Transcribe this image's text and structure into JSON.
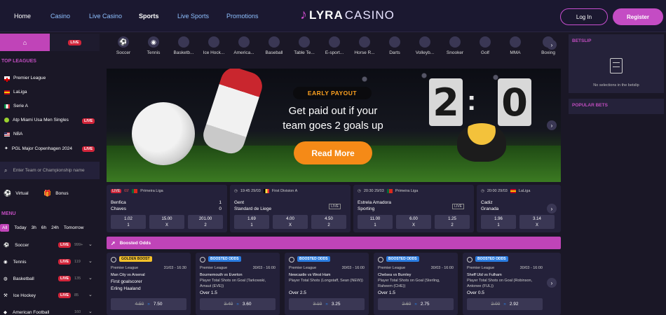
{
  "nav": {
    "items": [
      "Home",
      "Casino",
      "Live Casino",
      "Sports",
      "Live Sports",
      "Promotions"
    ],
    "logo_bold": "LYRA",
    "logo_light": "CASINO",
    "login": "Log In",
    "register": "Register"
  },
  "sidebar": {
    "live_tab": "LIVE",
    "top_leagues_title": "TOP LEAGUES",
    "leagues": [
      {
        "name": "Premier League",
        "live": ""
      },
      {
        "name": "LaLiga",
        "live": ""
      },
      {
        "name": "Serie A",
        "live": ""
      },
      {
        "name": "Atp Miami Usa Men Singles",
        "live": "LIVE"
      },
      {
        "name": "NBA",
        "live": ""
      },
      {
        "name": "PGL Major Copenhagen 2024",
        "live": "LIVE"
      }
    ],
    "search_placeholder": "Enter Team or Championship name",
    "virtual": "Virtual",
    "bonus": "Bonus",
    "menu_title": "MENU",
    "filters": [
      "All",
      "Today",
      "3h",
      "6h",
      "24h",
      "Tomorrow"
    ],
    "sports": [
      {
        "name": "Soccer",
        "live": "LIVE",
        "count": "999+"
      },
      {
        "name": "Tennis",
        "live": "LIVE",
        "count": "119"
      },
      {
        "name": "Basketball",
        "live": "LIVE",
        "count": "135"
      },
      {
        "name": "Ice Hockey",
        "live": "LIVE",
        "count": "85"
      },
      {
        "name": "American Football",
        "live": "",
        "count": "160"
      }
    ]
  },
  "sportsbar": [
    "Soccer",
    "Tennis",
    "Basketb...",
    "Ice Hock...",
    "America...",
    "Baseball",
    "Table Te...",
    "E-sport...",
    "Horse R...",
    "Darts",
    "Volleyb...",
    "Snooker",
    "Golf",
    "MMA",
    "Boxing"
  ],
  "banner": {
    "tag": "EARLY PAYOUT",
    "headline_1": "Get paid out if your",
    "headline_2": "team goes 2 goals up",
    "button": "Read More",
    "score_home": "2",
    "score_away": "0"
  },
  "matches": [
    {
      "status": "LIVE",
      "minute": "69'",
      "league": "Primeira Liga",
      "team1": "Benfica",
      "team2": "Chaves",
      "score1": "1",
      "score2": "0",
      "odds": [
        [
          "1.02",
          "1"
        ],
        [
          "15.00",
          "X"
        ],
        [
          "201.00",
          "2"
        ]
      ],
      "livetag": ""
    },
    {
      "status": "",
      "minute": "19:45 29/03",
      "league": "First Division A",
      "team1": "Gent",
      "team2": "Standard de Liege",
      "score1": "",
      "score2": "",
      "odds": [
        [
          "1.69",
          "1"
        ],
        [
          "4.00",
          "X"
        ],
        [
          "4.50",
          "2"
        ]
      ],
      "livetag": "LIVE"
    },
    {
      "status": "",
      "minute": "20:30 29/03",
      "league": "Primeira Liga",
      "team1": "Estrela Amadora",
      "team2": "Sporting",
      "score1": "",
      "score2": "",
      "odds": [
        [
          "11.00",
          "1"
        ],
        [
          "6.00",
          "X"
        ],
        [
          "1.25",
          "2"
        ]
      ],
      "livetag": "LIVE"
    },
    {
      "status": "",
      "minute": "20:00 29/03",
      "league": "LaLiga",
      "team1": "Cadiz",
      "team2": "Granada",
      "score1": "",
      "score2": "",
      "odds": [
        [
          "1.96",
          "1"
        ],
        [
          "3.14",
          "X"
        ],
        [
          "",
          ""
        ]
      ],
      "livetag": ""
    }
  ],
  "boosted": {
    "title": "Boosted Odds",
    "cards": [
      {
        "tag": "GOLDEN BOOST",
        "league": "Premier League",
        "date": "31/03 - 16:30",
        "title": "Man City vs Arsenal",
        "sub1": "First goalscorer",
        "sub2": "Erling Haaland",
        "old": "4.50",
        "new": "7.50",
        "gold": true
      },
      {
        "tag": "BOOSTED ODDS",
        "league": "Premier League",
        "date": "30/03 - 16:00",
        "title": "Bournemouth vs Everton",
        "sub1": "Player Total Shots on Goal (Tarkowski, Arnaut (EVE))",
        "sub2": "Over 1.5",
        "old": "3.40",
        "new": "3.60",
        "gold": false
      },
      {
        "tag": "BOOSTED ODDS",
        "league": "Premier League",
        "date": "30/03 - 16:00",
        "title": "Newcastle vs West Ham",
        "sub1": "Player Total Shots (Longstaff, Sean (NEW))",
        "sub2": "Over 2.5",
        "old": "3.10",
        "new": "3.25",
        "gold": false
      },
      {
        "tag": "BOOSTED ODDS",
        "league": "Premier League",
        "date": "30/03 - 16:00",
        "title": "Chelsea vs Burnley",
        "sub1": "Player Total Shots on Goal (Sterling, Raheem (CHE))",
        "sub2": "Over 1.5",
        "old": "2.60",
        "new": "2.75",
        "gold": false
      },
      {
        "tag": "BOOSTED ODDS",
        "league": "Premier League",
        "date": "30/03 - 16:00",
        "title": "Sheff Utd vs Fulham",
        "sub1": "Player Total Shots on Goal (Robinson, Antonee (FUL))",
        "sub2": "Over 0.5",
        "old": "2.00",
        "new": "2.92",
        "gold": false
      }
    ]
  },
  "right": {
    "betslip_title": "BETSLIP",
    "betslip_empty": "No selections in the betslip",
    "popular_title": "POPULAR BETS"
  },
  "colors": {
    "accent": "#c044b8",
    "bg": "#1a1726",
    "card": "#24213a",
    "live": "#d2253a",
    "orange": "#f58a17"
  }
}
